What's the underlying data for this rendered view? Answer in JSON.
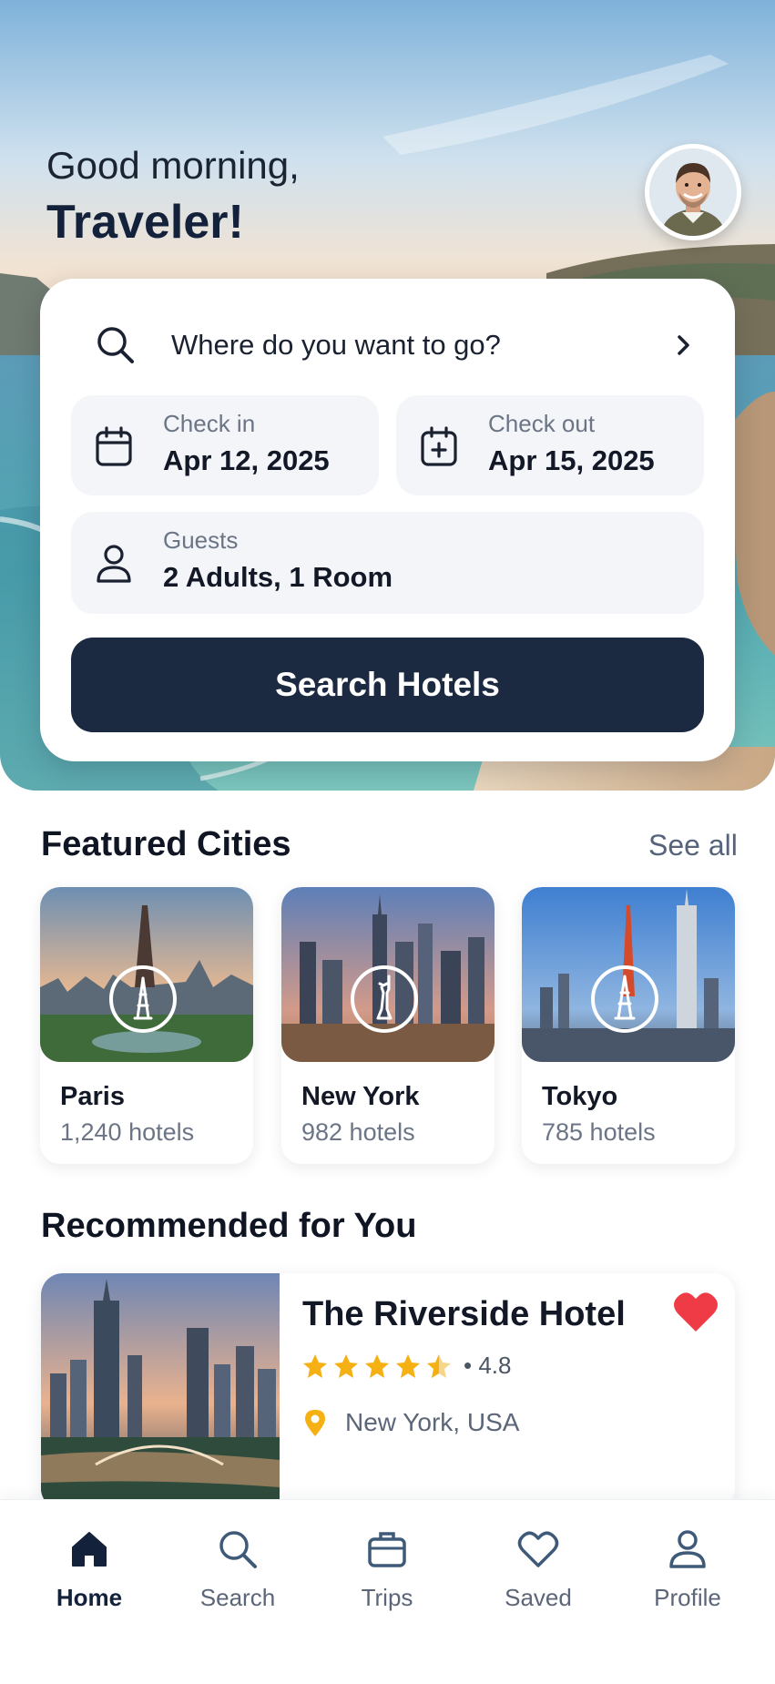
{
  "header": {
    "greeting_line1": "Good morning,",
    "greeting_line2": "Traveler!"
  },
  "search": {
    "destination_placeholder": "Where do you want to go?",
    "check_in_label": "Check in",
    "check_in_value": "Apr 12, 2025",
    "check_out_label": "Check out",
    "check_out_value": "Apr 15, 2025",
    "guests_label": "Guests",
    "guests_value": "2 Adults, 1 Room",
    "button_label": "Search Hotels"
  },
  "featured": {
    "title": "Featured Cities",
    "see_all": "See all",
    "cities": [
      {
        "name": "Paris",
        "count": "1,240 hotels",
        "icon": "eiffel-tower-icon"
      },
      {
        "name": "New York",
        "count": "982 hotels",
        "icon": "statue-of-liberty-icon"
      },
      {
        "name": "Tokyo",
        "count": "785 hotels",
        "icon": "tokyo-tower-icon"
      }
    ]
  },
  "recommended": {
    "title": "Recommended for You",
    "hotel": {
      "name": "The Riverside Hotel",
      "rating": "• 4.8",
      "stars": 4.5,
      "location": "New York, USA"
    }
  },
  "nav": {
    "items": [
      {
        "label": "Home",
        "icon": "home-icon",
        "active": true
      },
      {
        "label": "Search",
        "icon": "search-icon",
        "active": false
      },
      {
        "label": "Trips",
        "icon": "briefcase-icon",
        "active": false
      },
      {
        "label": "Saved",
        "icon": "heart-icon",
        "active": false
      },
      {
        "label": "Profile",
        "icon": "user-icon",
        "active": false
      }
    ]
  },
  "colors": {
    "primary": "#1c2a41",
    "accent_star": "#f5b014",
    "heart": "#ef3b45",
    "pin": "#f5b014"
  }
}
